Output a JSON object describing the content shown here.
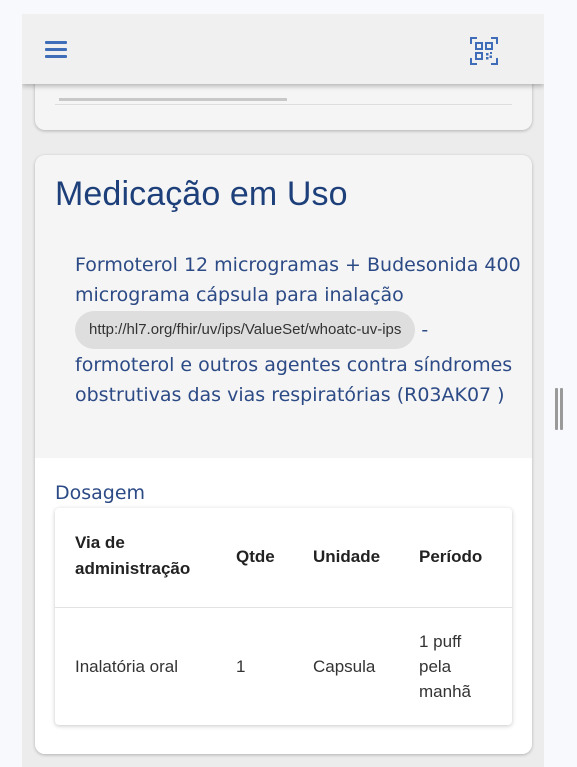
{
  "header": {
    "menu_icon": "hamburger-menu-icon",
    "qr_icon": "qr-code-scan-icon",
    "accent_color": "#3f6db7"
  },
  "section": {
    "title": "Medicação em Uso",
    "medication": {
      "name_line1": "Formoterol 12 microgramas + Budesonida 400",
      "name_line2": "micrograma cápsula para inalação",
      "system_url": "http://hl7.org/fhir/uv/ips/ValueSet/whoatc-uv-ips",
      "separator": "-",
      "class_line1": "formoterol e outros agentes contra síndromes",
      "class_line2": "obstrutivas das vias respiratórias (R03AK07 )"
    },
    "dosage": {
      "label": "Dosagem",
      "columns": {
        "route_l1": "Via de",
        "route_l2": "administração",
        "qty": "Qtde",
        "unit": "Unidade",
        "period": "Período"
      },
      "rows": [
        {
          "route": "Inalatória oral",
          "qty": "1",
          "unit": "Capsula",
          "period_l1": "1 puff",
          "period_l2": "pela",
          "period_l3": "manhã"
        }
      ]
    }
  },
  "colors": {
    "title": "#1d3f7a",
    "text": "#2c4a85",
    "card_bg": "#f5f5f5",
    "chip_bg": "#dedede"
  }
}
